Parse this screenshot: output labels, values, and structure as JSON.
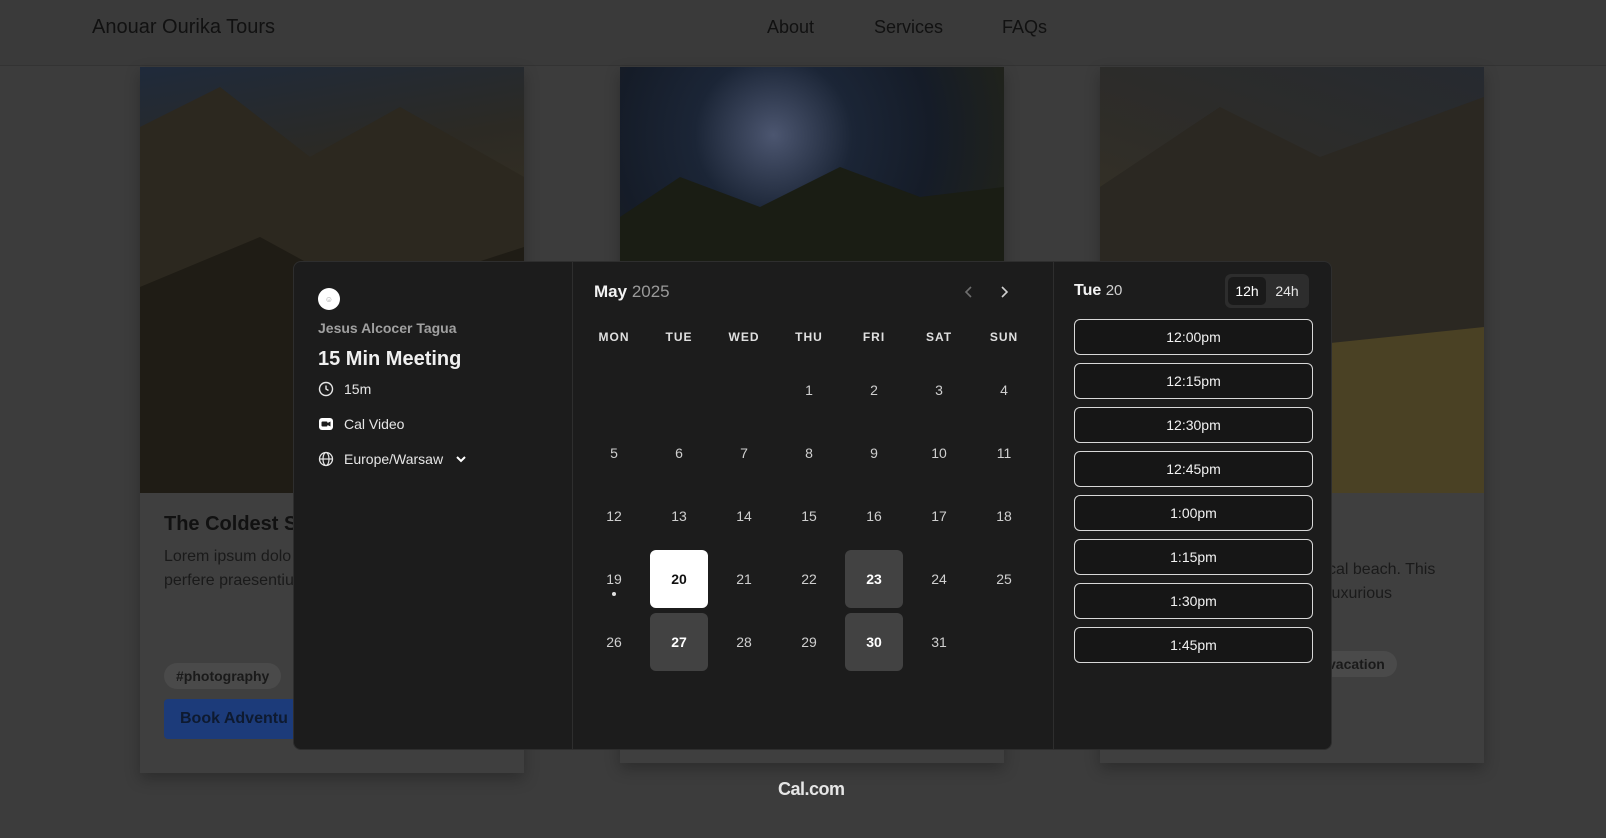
{
  "site": {
    "brand": "Anouar Ourika Tours",
    "nav": [
      "About",
      "Services",
      "FAQs"
    ],
    "cards": [
      {
        "title": "The Coldest S",
        "text": "Lorem ipsum dolo adipisicing elit. Vo Maiores et perfere praesentium nihil",
        "tag": "#photography",
        "button": "Book Adventu"
      },
      {
        "text": "cal beach. This luxurious",
        "tag": "vacation"
      }
    ]
  },
  "booking": {
    "organizer": "Jesus Alcocer Tagua",
    "event_title": "15 Min Meeting",
    "duration": "15m",
    "location": "Cal Video",
    "timezone": "Europe/Warsaw",
    "month": "May",
    "year": "2025",
    "prev_icon": "chevron-left-icon",
    "next_icon": "chevron-right-icon",
    "weekdays": [
      "MON",
      "TUE",
      "WED",
      "THU",
      "FRI",
      "SAT",
      "SUN"
    ],
    "selected_weekday": "Tue",
    "selected_day": "20",
    "format_options": [
      "12h",
      "24h"
    ],
    "active_format": "12h",
    "time_slots": [
      "12:00pm",
      "12:15pm",
      "12:30pm",
      "12:45pm",
      "1:00pm",
      "1:15pm",
      "1:30pm",
      "1:45pm"
    ],
    "days": [
      {
        "d": "1",
        "state": "none"
      },
      {
        "d": "2",
        "state": "none"
      },
      {
        "d": "3",
        "state": "none"
      },
      {
        "d": "4",
        "state": "none"
      },
      {
        "d": "5",
        "state": "none"
      },
      {
        "d": "6",
        "state": "none"
      },
      {
        "d": "7",
        "state": "none"
      },
      {
        "d": "8",
        "state": "none"
      },
      {
        "d": "9",
        "state": "none"
      },
      {
        "d": "10",
        "state": "none"
      },
      {
        "d": "11",
        "state": "none"
      },
      {
        "d": "12",
        "state": "none"
      },
      {
        "d": "13",
        "state": "none"
      },
      {
        "d": "14",
        "state": "none"
      },
      {
        "d": "15",
        "state": "none"
      },
      {
        "d": "16",
        "state": "none"
      },
      {
        "d": "17",
        "state": "none"
      },
      {
        "d": "18",
        "state": "none"
      },
      {
        "d": "19",
        "state": "today"
      },
      {
        "d": "20",
        "state": "selected"
      },
      {
        "d": "21",
        "state": "none"
      },
      {
        "d": "22",
        "state": "none"
      },
      {
        "d": "23",
        "state": "available"
      },
      {
        "d": "24",
        "state": "none"
      },
      {
        "d": "25",
        "state": "none"
      },
      {
        "d": "26",
        "state": "none"
      },
      {
        "d": "27",
        "state": "available"
      },
      {
        "d": "28",
        "state": "none"
      },
      {
        "d": "29",
        "state": "none"
      },
      {
        "d": "30",
        "state": "available"
      },
      {
        "d": "31",
        "state": "none"
      }
    ],
    "first_weekday_index": 3,
    "footer_brand": "Cal.com"
  }
}
